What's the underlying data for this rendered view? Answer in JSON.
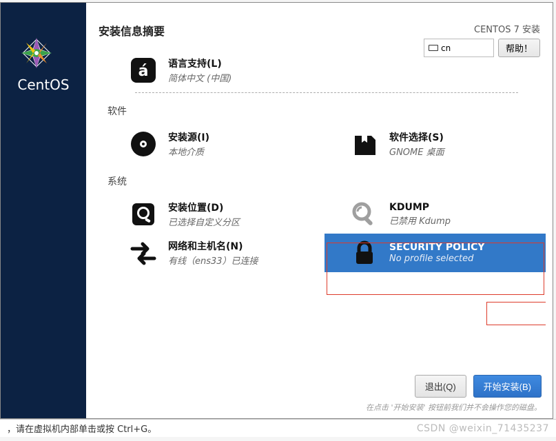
{
  "header": {
    "title": "安装信息摘要",
    "distro": "CENTOS 7 安装",
    "lang_indicator": "cn",
    "help_button": "帮助！"
  },
  "sidebar": {
    "brand": "CentOS"
  },
  "sections": {
    "software": "软件",
    "system": "系统"
  },
  "spokes": {
    "language": {
      "title": "语言支持(L)",
      "sub": "简体中文 (中国)"
    },
    "source": {
      "title": "安装源(I)",
      "sub": "本地介质"
    },
    "software": {
      "title": "软件选择(S)",
      "sub": "GNOME 桌面"
    },
    "dest": {
      "title": "安装位置(D)",
      "sub": "已选择自定义分区"
    },
    "kdump": {
      "title": "KDUMP",
      "sub": "已禁用 Kdump"
    },
    "network": {
      "title": "网络和主机名(N)",
      "sub": "有线（ens33）已连接"
    },
    "security": {
      "title": "SECURITY POLICY",
      "sub": "No profile selected"
    }
  },
  "footer": {
    "quit": "退出(Q)",
    "begin": "开始安装(B)",
    "note": "在点击 '开始安装' 按钮前我们并不会操作您的磁盘。"
  },
  "statusbar": {
    "hint": "，请在虚拟机内部单击或按 Ctrl+G。"
  },
  "colors": {
    "sidebar_bg": "#0c2243",
    "accent": "#3279c8",
    "highlight_red": "#dd3a2a"
  }
}
